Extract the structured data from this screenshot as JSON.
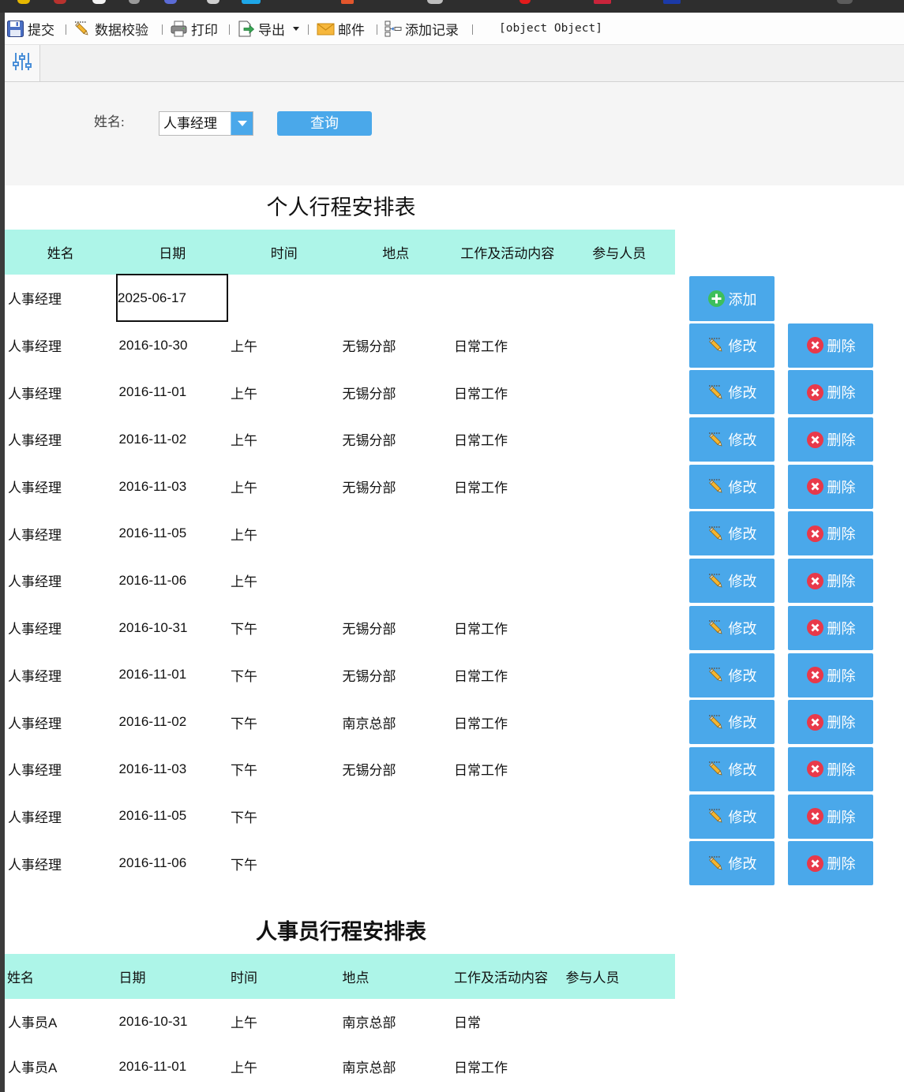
{
  "theme": {
    "accent": "#4aa8ea",
    "table_header_bg": "#adf5e8"
  },
  "toolbar": {
    "items": [
      {
        "label": "提交",
        "icon": "save-icon"
      },
      {
        "label": "数据校验",
        "icon": "pencil-ruler-icon"
      },
      {
        "label": "打印",
        "icon": "printer-icon"
      },
      {
        "label": "导出",
        "icon": "export-icon",
        "has_dropdown": true
      },
      {
        "label": "邮件",
        "icon": "envelope-icon"
      },
      {
        "label": "添加记录",
        "icon": "add-record-icon"
      }
    ],
    "status_text": "[object Object]"
  },
  "side_tab": {
    "icon": "sliders-icon"
  },
  "query": {
    "name_label": "姓名:",
    "name_value": "人事经理",
    "submit_label": "查询"
  },
  "schedule1": {
    "title": "个人行程安排表",
    "headers": [
      "姓名",
      "日期",
      "时间",
      "地点",
      "工作及活动内容",
      "参与人员"
    ],
    "new_row": {
      "name": "人事经理",
      "date": "2025-06-17"
    },
    "add_label": "添加",
    "edit_label": "修改",
    "delete_label": "删除",
    "rows": [
      {
        "name": "人事经理",
        "date": "2016-10-30",
        "time": "上午",
        "location": "无锡分部",
        "content": "日常工作",
        "participants": ""
      },
      {
        "name": "人事经理",
        "date": "2016-11-01",
        "time": "上午",
        "location": "无锡分部",
        "content": "日常工作",
        "participants": ""
      },
      {
        "name": "人事经理",
        "date": "2016-11-02",
        "time": "上午",
        "location": "无锡分部",
        "content": "日常工作",
        "participants": ""
      },
      {
        "name": "人事经理",
        "date": "2016-11-03",
        "time": "上午",
        "location": "无锡分部",
        "content": "日常工作",
        "participants": ""
      },
      {
        "name": "人事经理",
        "date": "2016-11-05",
        "time": "上午",
        "location": "",
        "content": "",
        "participants": ""
      },
      {
        "name": "人事经理",
        "date": "2016-11-06",
        "time": "上午",
        "location": "",
        "content": "",
        "participants": ""
      },
      {
        "name": "人事经理",
        "date": "2016-10-31",
        "time": "下午",
        "location": "无锡分部",
        "content": "日常工作",
        "participants": ""
      },
      {
        "name": "人事经理",
        "date": "2016-11-01",
        "time": "下午",
        "location": "无锡分部",
        "content": "日常工作",
        "participants": ""
      },
      {
        "name": "人事经理",
        "date": "2016-11-02",
        "time": "下午",
        "location": "南京总部",
        "content": "日常工作",
        "participants": ""
      },
      {
        "name": "人事经理",
        "date": "2016-11-03",
        "time": "下午",
        "location": "无锡分部",
        "content": "日常工作",
        "participants": ""
      },
      {
        "name": "人事经理",
        "date": "2016-11-05",
        "time": "下午",
        "location": "",
        "content": "",
        "participants": ""
      },
      {
        "name": "人事经理",
        "date": "2016-11-06",
        "time": "下午",
        "location": "",
        "content": "",
        "participants": ""
      }
    ]
  },
  "schedule2": {
    "title": "人事员行程安排表",
    "headers": [
      "姓名",
      "日期",
      "时间",
      "地点",
      "工作及活动内容",
      "参与人员"
    ],
    "rows": [
      {
        "name": "人事员A",
        "date": "2016-10-31",
        "time": "上午",
        "location": "南京总部",
        "content": "日常",
        "participants": ""
      },
      {
        "name": "人事员A",
        "date": "2016-11-01",
        "time": "上午",
        "location": "南京总部",
        "content": "日常工作",
        "participants": ""
      }
    ]
  }
}
